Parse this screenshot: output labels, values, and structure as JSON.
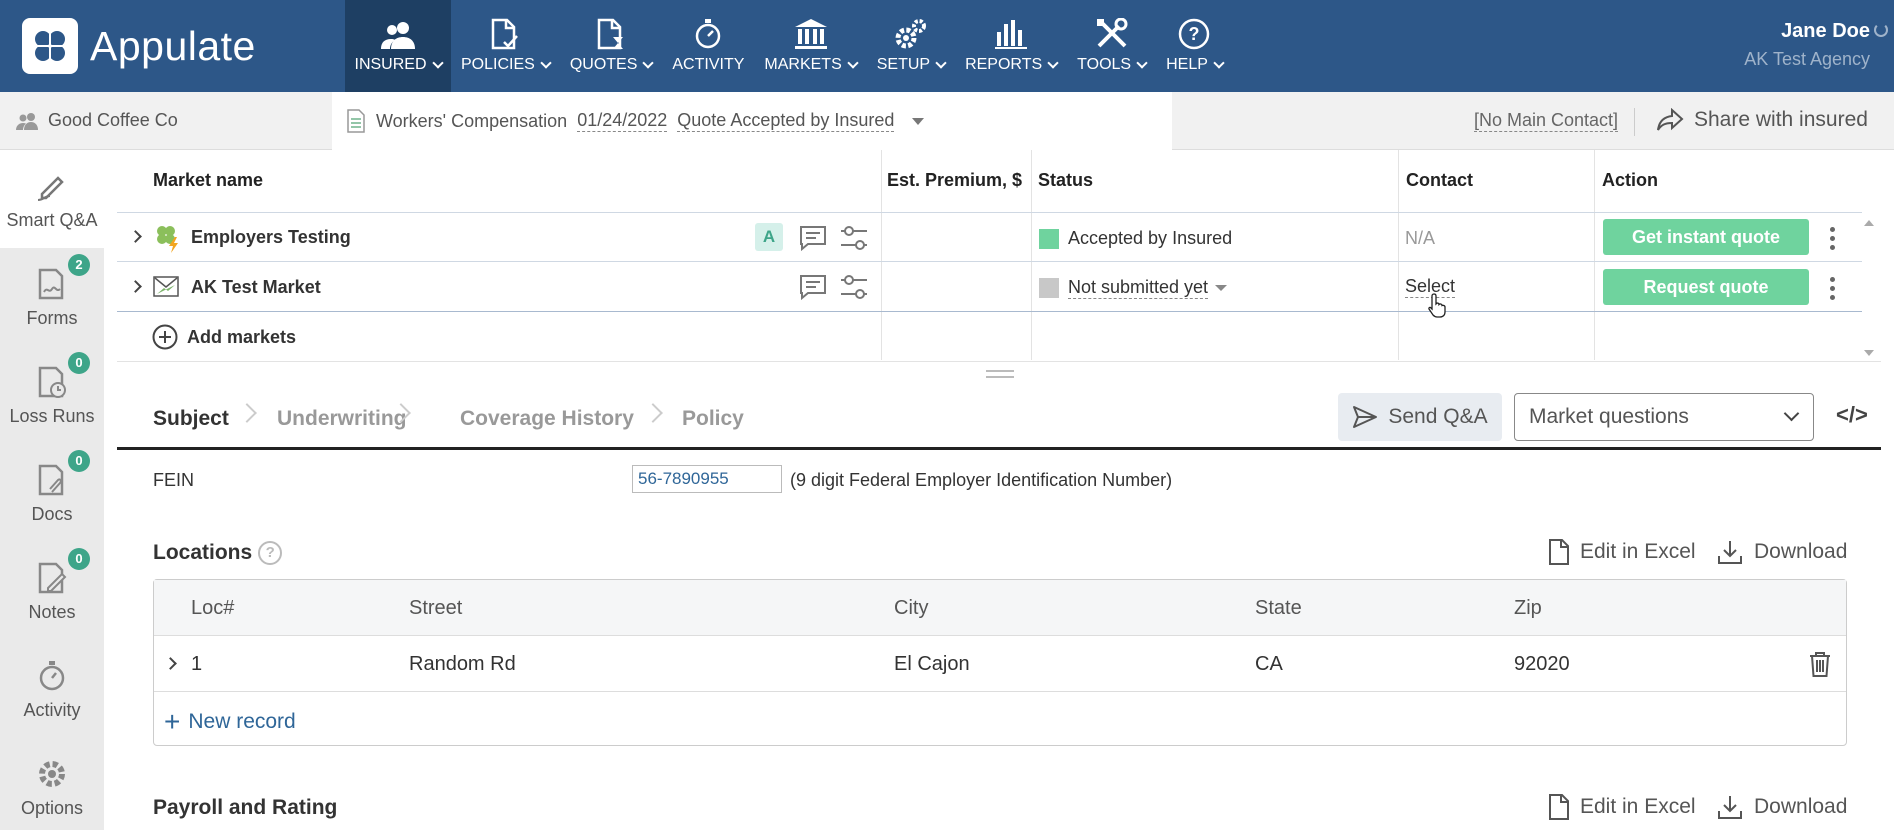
{
  "app": {
    "name": "Appulate"
  },
  "nav": [
    {
      "id": "insured",
      "label": "INSURED",
      "active": true
    },
    {
      "id": "policies",
      "label": "POLICIES"
    },
    {
      "id": "quotes",
      "label": "QUOTES"
    },
    {
      "id": "activity",
      "label": "ACTIVITY"
    },
    {
      "id": "markets",
      "label": "MARKETS"
    },
    {
      "id": "setup",
      "label": "SETUP"
    },
    {
      "id": "reports",
      "label": "REPORTS"
    },
    {
      "id": "tools",
      "label": "TOOLS"
    },
    {
      "id": "help",
      "label": "HELP"
    }
  ],
  "user": {
    "name": "Jane Doe",
    "agency": "AK Test Agency"
  },
  "subbar": {
    "insured_name": "Good Coffee Co",
    "policy_type": "Workers' Compensation",
    "date": "01/24/2022",
    "status": "Quote Accepted by Insured",
    "main_contact": "[No Main Contact]",
    "share": "Share with insured"
  },
  "sidebar": [
    {
      "label": "Smart Q&A",
      "icon": "pen-icon"
    },
    {
      "label": "Forms",
      "icon": "forms-icon",
      "badge": "2"
    },
    {
      "label": "Loss Runs",
      "icon": "loss-runs-icon",
      "badge": "0"
    },
    {
      "label": "Docs",
      "icon": "docs-icon",
      "badge": "0"
    },
    {
      "label": "Notes",
      "icon": "notes-icon",
      "badge": "0"
    },
    {
      "label": "Activity",
      "icon": "activity-icon"
    },
    {
      "label": "Options",
      "icon": "gear-icon"
    }
  ],
  "markets_table": {
    "headers": {
      "name": "Market name",
      "premium": "Est. Premium, $",
      "status": "Status",
      "contact": "Contact",
      "action": "Action"
    },
    "rows": [
      {
        "name": "Employers Testing",
        "badge": "A",
        "status": "Accepted by Insured",
        "status_color": "#6fd39e",
        "contact": "N/A",
        "action": "Get instant quote"
      },
      {
        "name": "AK Test Market",
        "status": "Not submitted yet",
        "status_color": "#c8c8c8",
        "contact": "Select",
        "action": "Request quote"
      }
    ],
    "add_markets": "Add markets"
  },
  "qa": {
    "tabs": [
      "Subject",
      "Underwriting",
      "Coverage History",
      "Policy"
    ],
    "send_qa": "Send Q&A",
    "market_questions": "Market questions",
    "code_toggle": "</>",
    "fein_label": "FEIN",
    "fein_value": "56-7890955",
    "fein_hint": "(9 digit Federal Employer Identification Number)",
    "locations_title": "Locations",
    "edit_excel": "Edit in Excel",
    "download": "Download",
    "loc_headers": [
      "Loc#",
      "Street",
      "City",
      "State",
      "Zip"
    ],
    "loc_rows": [
      {
        "loc": "1",
        "street": "Random Rd",
        "city": "El Cajon",
        "state": "CA",
        "zip": "92020"
      }
    ],
    "new_record": "New record",
    "payroll_title": "Payroll and Rating"
  },
  "colors": {
    "nav_bg": "#2d5788",
    "nav_active": "#1e3f63",
    "accent_green": "#6fd39e",
    "badge_green": "#3ea589",
    "link_blue": "#2f6698"
  }
}
